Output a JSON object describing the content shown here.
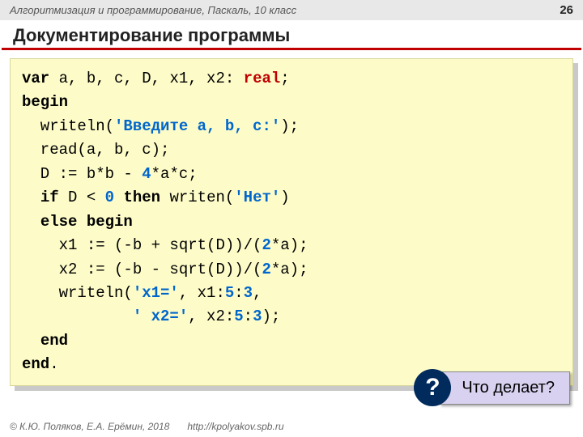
{
  "header": {
    "breadcrumb": "Алгоритмизация и программирование, Паскаль, 10 класс",
    "page": "26"
  },
  "title": "Документирование программы",
  "code": {
    "l1a": "var",
    "l1b": " a, b, c, D, x1, x2: ",
    "l1c": "real",
    "l1d": ";",
    "l2": "begin",
    "l3a": "  writeln(",
    "l3b": "'Введите a, b, c:'",
    "l3c": ");",
    "l4": "  read(a, b, c);",
    "l5a": "  D := b*b - ",
    "l5b": "4",
    "l5c": "*a*c;",
    "l6a": "  ",
    "l6b": "if",
    "l6c": " D < ",
    "l6d": "0",
    "l6e": " ",
    "l6f": "then",
    "l6g": " writen(",
    "l6h": "'Нет'",
    "l6i": ")",
    "l7a": "  ",
    "l7b": "else begin",
    "l8a": "    x1 := (-b + sqrt(D))/(",
    "l8b": "2",
    "l8c": "*a);",
    "l9a": "    x2 := (-b - sqrt(D))/(",
    "l9b": "2",
    "l9c": "*a);",
    "l10a": "    writeln(",
    "l10b": "'x1='",
    "l10c": ", x1:",
    "l10d": "5",
    "l10e": ":",
    "l10f": "3",
    "l10g": ",",
    "l11a": "            ",
    "l11b": "' x2='",
    "l11c": ", x2:",
    "l11d": "5",
    "l11e": ":",
    "l11f": "3",
    "l11g": ");",
    "l12a": "  ",
    "l12b": "end",
    "l13a": "end",
    "l13b": "."
  },
  "callout": {
    "badge": "?",
    "text": "Что делает?"
  },
  "footer": {
    "copyright": "© К.Ю. Поляков, Е.А. Ерёмин, 2018",
    "url": "http://kpolyakov.spb.ru"
  }
}
